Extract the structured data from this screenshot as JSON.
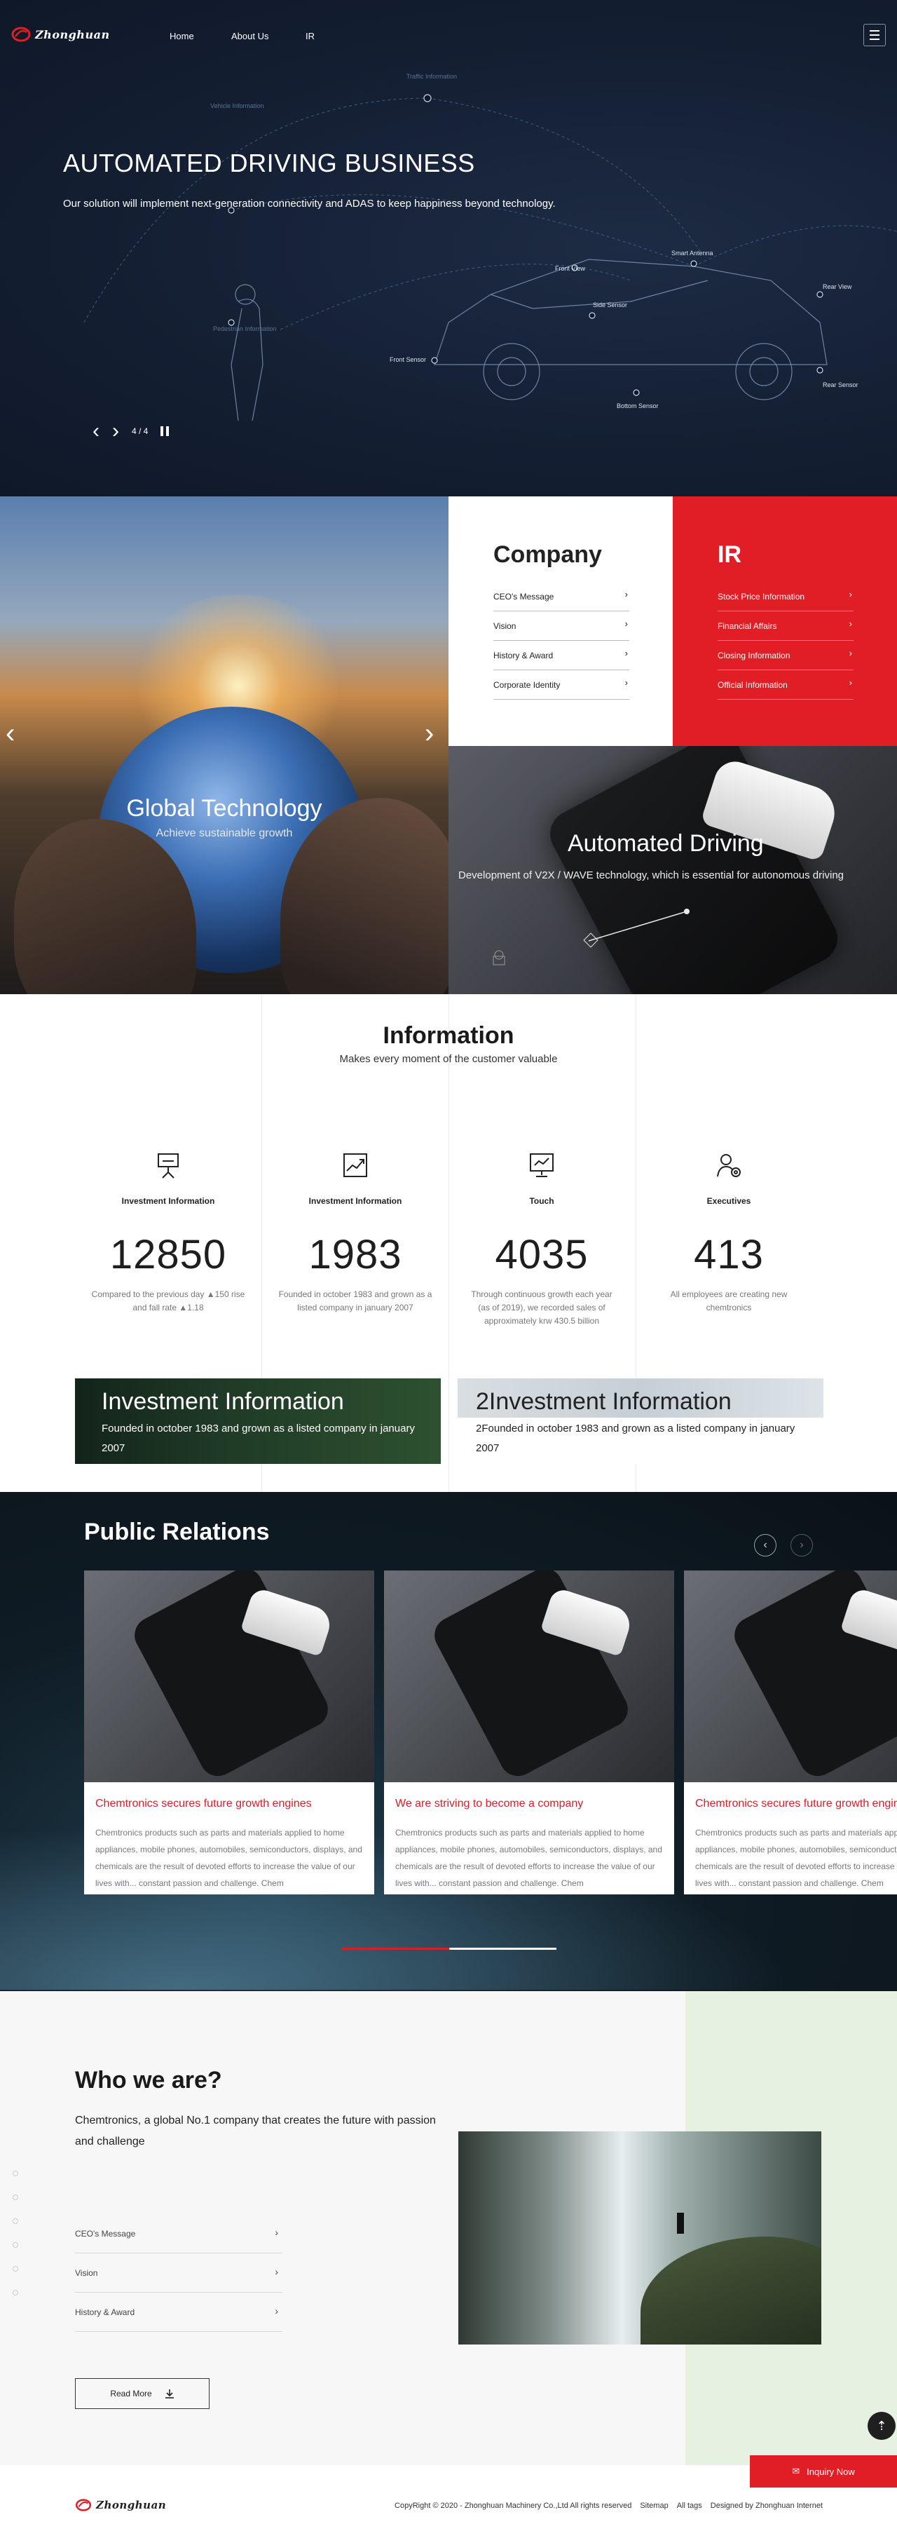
{
  "brand": {
    "name": "Zhonghuan"
  },
  "nav": {
    "items": [
      "Home",
      "About Us",
      "IR"
    ],
    "menu_icon": "hamburger-icon"
  },
  "hero": {
    "title": "AUTOMATED DRIVING BUSINESS",
    "subtitle": "Our solution will implement next-generation connectivity and ADAS to keep happiness beyond technology.",
    "slide_counter": "4 / 4",
    "labels": [
      "Traffic Information",
      "Vehicle Information",
      "Pedestrian Information",
      "Front View",
      "Smart Antenna",
      "Rear View",
      "Side Sensor",
      "Front Sensor",
      "Rear Sensor",
      "Bottom Sensor"
    ]
  },
  "company": {
    "title": "Company",
    "items": [
      "CEO's Message",
      "Vision",
      "History & Award",
      "Corporate Identity"
    ]
  },
  "ir": {
    "title": "IR",
    "items": [
      "Stock Price Information",
      "Financial Affairs",
      "Closing Information",
      "Official Information"
    ]
  },
  "globe": {
    "title": "Global Technology",
    "subtitle": "Achieve sustainable growth"
  },
  "automated": {
    "title": "Automated Driving",
    "subtitle": "Development of V2X / WAVE technology, which is essential for autonomous driving"
  },
  "information": {
    "title": "Information",
    "subtitle": "Makes every moment of the customer valuable",
    "stats": [
      {
        "label": "Investment Information",
        "value": "12850",
        "desc": "Compared to the previous day ▲150 rise and fall rate ▲1.18",
        "icon": "presentation-icon"
      },
      {
        "label": "Investment Information",
        "value": "1983",
        "desc": "Founded in october 1983 and grown as a listed company in january 2007",
        "icon": "growth-chart-icon"
      },
      {
        "label": "Touch",
        "value": "4035",
        "desc": "Through continuous growth each year (as of 2019), we recorded sales of approximately krw 430.5 billion",
        "icon": "monitor-chart-icon"
      },
      {
        "label": "Executives",
        "value": "413",
        "desc": "All employees are creating new chemtronics",
        "icon": "people-gear-icon"
      }
    ],
    "cards": [
      {
        "title": "Investment Information",
        "desc": "Founded in october 1983 and grown as a listed company in january 2007"
      },
      {
        "title": "2Investment Information",
        "desc": "2Founded in october 1983 and grown as a listed company in january 2007"
      }
    ]
  },
  "public_relations": {
    "title": "Public Relations",
    "cards": [
      {
        "title": "Chemtronics secures future growth engines",
        "desc": "Chemtronics products such as parts and materials applied to home appliances, mobile phones, automobiles, semiconductors, displays, and chemicals are the result of devoted efforts to increase the value of our lives with... constant passion and challenge. Chem"
      },
      {
        "title": "We are striving to become a company",
        "desc": "Chemtronics products such as parts and materials applied to home appliances, mobile phones, automobiles, semiconductors, displays, and chemicals are the result of devoted efforts to increase the value of our lives with... constant passion and challenge. Chem"
      },
      {
        "title": "Chemtronics secures future growth engines",
        "desc": "Chemtronics products such as parts and materials applied to home appliances, mobile phones, automobiles, semiconductors, displays, and chemicals are the result of devoted efforts to increase the value of our lives with... constant passion and challenge. Chem"
      }
    ],
    "progress": 0.5
  },
  "who": {
    "title": "Who we are?",
    "subtitle": "Chemtronics, a global No.1 company that creates the future with passion and challenge",
    "items": [
      "CEO's Message",
      "Vision",
      "History & Award"
    ],
    "read_more": "Read More"
  },
  "inquiry": {
    "label": "Inquiry Now"
  },
  "footer": {
    "copyright": "CopyRight © 2020 - Zhonghuan Machinery Co.,Ltd All rights reserved",
    "links": [
      "Sitemap",
      "All tags"
    ],
    "designed": "Designed by Zhonghuan Internet"
  },
  "colors": {
    "accent": "#e11d25",
    "hero_bg": "#141f33",
    "who_green": "#e7f1e2"
  }
}
